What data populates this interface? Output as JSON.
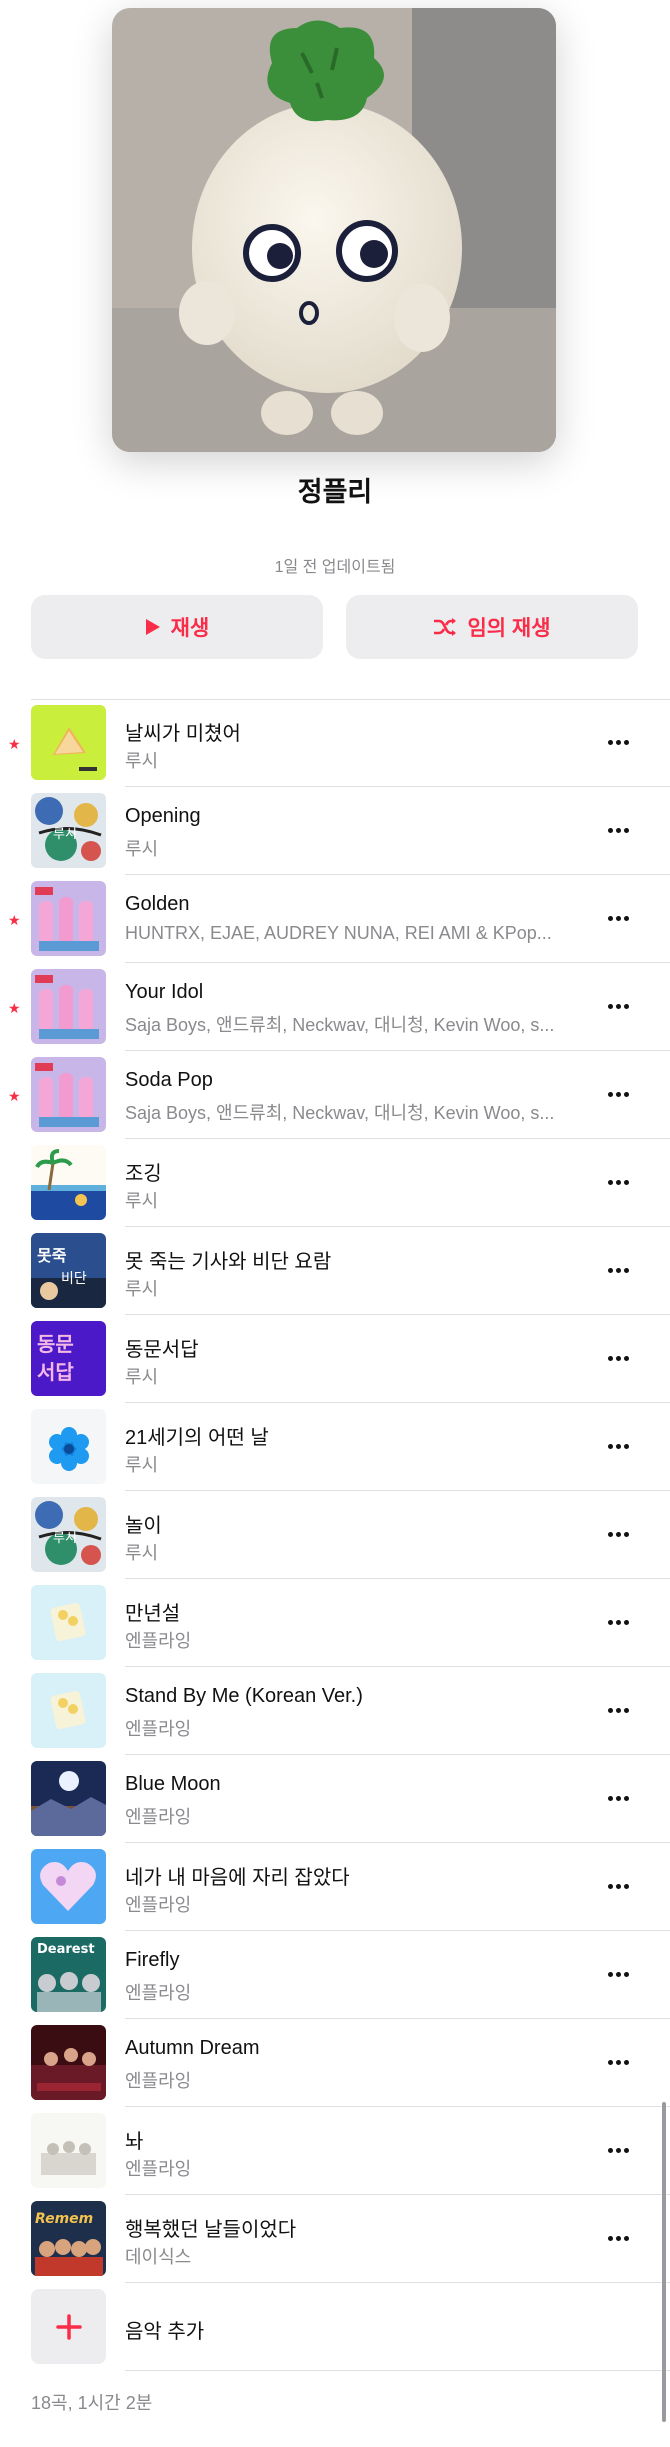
{
  "playlist": {
    "title": "정플리",
    "updated": "1일 전 업데이트됨",
    "cover_icon": "radish-plush-photo"
  },
  "actions": {
    "play_label": "재생",
    "play_icon": "play-icon",
    "shuffle_label": "임의 재생",
    "shuffle_icon": "shuffle-icon"
  },
  "tracks": [
    {
      "title": "날씨가 미쳤어",
      "artist": "루시",
      "starred": true,
      "art": "art-yellowgreen"
    },
    {
      "title": "Opening",
      "artist": "루시",
      "starred": false,
      "art": "art-doodle"
    },
    {
      "title": "Golden",
      "artist": "HUNTRX, EJAE, AUDREY NUNA, REI AMI & KPop...",
      "starred": true,
      "art": "art-pink"
    },
    {
      "title": "Your Idol",
      "artist": "Saja Boys, 앤드류최, Neckwav, 대니청, Kevin Woo, s...",
      "starred": true,
      "art": "art-pink"
    },
    {
      "title": "Soda Pop",
      "artist": "Saja Boys, 앤드류최, Neckwav, 대니청, Kevin Woo, s...",
      "starred": true,
      "art": "art-pink"
    },
    {
      "title": "조깅",
      "artist": "루시",
      "starred": false,
      "art": "art-beach"
    },
    {
      "title": "못 죽는 기사와 비단 요람",
      "artist": "루시",
      "starred": false,
      "art": "art-blue-dark"
    },
    {
      "title": "동문서답",
      "artist": "루시",
      "starred": false,
      "art": "art-purple"
    },
    {
      "title": "21세기의 어떤 날",
      "artist": "루시",
      "starred": false,
      "art": "art-flower"
    },
    {
      "title": "놀이",
      "artist": "루시",
      "starred": false,
      "art": "art-doodle"
    },
    {
      "title": "만년설",
      "artist": "엔플라잉",
      "starred": false,
      "art": "art-paleblue"
    },
    {
      "title": "Stand By Me (Korean Ver.)",
      "artist": "엔플라잉",
      "starred": false,
      "art": "art-paleblue"
    },
    {
      "title": "Blue Moon",
      "artist": "엔플라잉",
      "starred": false,
      "art": "art-moon"
    },
    {
      "title": "네가 내 마음에 자리 잡았다",
      "artist": "엔플라잉",
      "starred": false,
      "art": "art-heart"
    },
    {
      "title": "Firefly",
      "artist": "엔플라잉",
      "starred": false,
      "art": "art-dearest"
    },
    {
      "title": "Autumn Dream",
      "artist": "엔플라잉",
      "starred": false,
      "art": "art-crimson"
    },
    {
      "title": "놔",
      "artist": "엔플라잉",
      "starred": false,
      "art": "art-white"
    },
    {
      "title": "행복했던 날들이었다",
      "artist": "데이식스",
      "starred": false,
      "art": "art-remember"
    }
  ],
  "dearest_text": "Dearest",
  "add_music_label": "음악 추가",
  "footer_summary": "18곡, 1시간 2분",
  "colors": {
    "accent": "#fa2d48",
    "secondary_text": "#8a8a8e",
    "button_bg": "#ededf0"
  }
}
